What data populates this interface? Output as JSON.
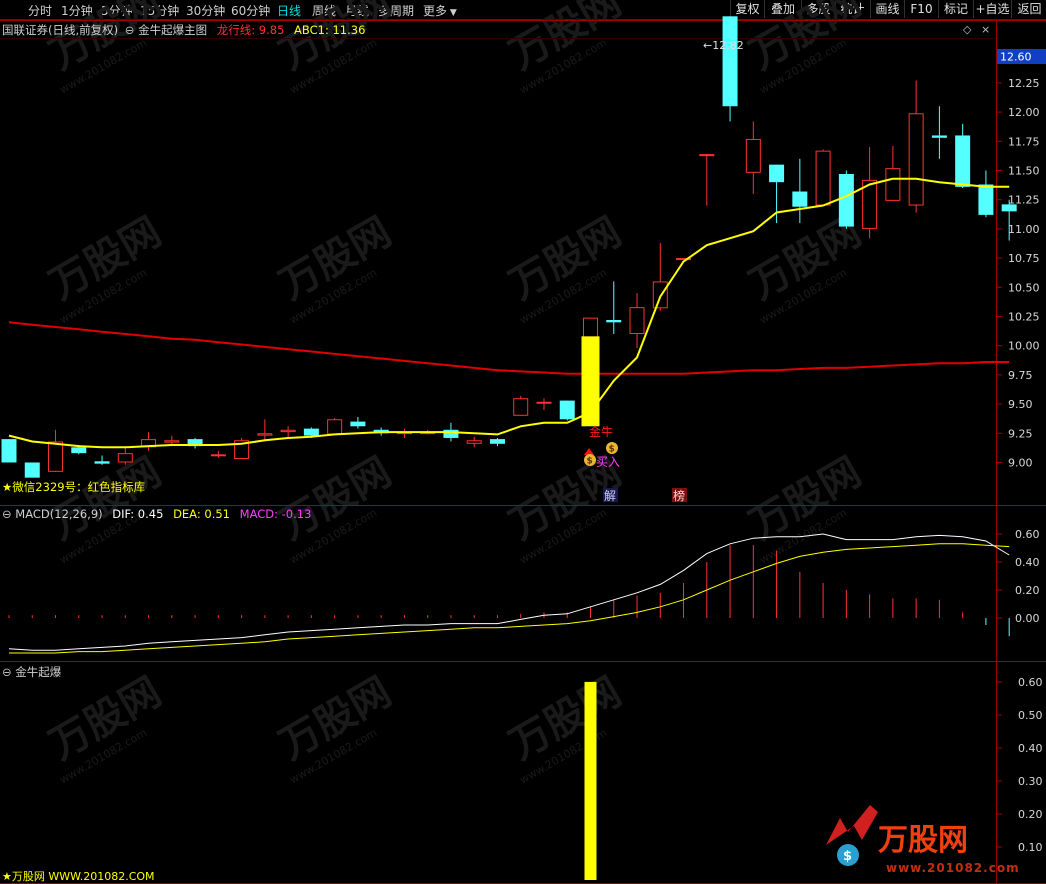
{
  "toolbar": {
    "periods": [
      {
        "label": "分时"
      },
      {
        "label": "1分钟"
      },
      {
        "label": "5分钟"
      },
      {
        "label": "15分钟"
      },
      {
        "label": "30分钟"
      },
      {
        "label": "60分钟"
      },
      {
        "label": "日线"
      },
      {
        "label": "周线"
      },
      {
        "label": "月线"
      },
      {
        "label": "多周期"
      },
      {
        "label": "更多"
      }
    ],
    "active_period": "日线",
    "tools": [
      {
        "label": "复权"
      },
      {
        "label": "叠加"
      },
      {
        "label": "多股"
      },
      {
        "label": "统计"
      },
      {
        "label": "画线"
      },
      {
        "label": "F10"
      },
      {
        "label": "标记"
      },
      {
        "label": "+自选"
      },
      {
        "label": "返回"
      }
    ]
  },
  "main_panel": {
    "stock": "国联证券(日线,前复权)",
    "indicator": "金牛起爆主图",
    "line1_label": "龙行线: 9.85",
    "line2_label": "ABC1: 11.36",
    "wechat_note": "★微信2329号：红色指标库",
    "signal_jin": "金牛",
    "signal_buy": "买入",
    "marker_jie": "解",
    "marker_bang": "榜",
    "max_label": "12.82",
    "current_price_tag": "12.60"
  },
  "macd_panel": {
    "title": "MACD(12,26,9)",
    "dif_label": "DIF: 0.45",
    "dea_label": "DEA: 0.51",
    "macd_label": "MACD: -0.13"
  },
  "sub_panel": {
    "title": "金牛起爆",
    "footer": "★万股网 WWW.201082.COM"
  },
  "watermark": {
    "brand": "万股网",
    "url": "www.201082.com",
    "logo_url": "www.201082.com"
  },
  "colors": {
    "background": "#000000",
    "up": "#ff3232",
    "down": "#54ffff",
    "yellow": "#ffff00",
    "red_line": "#e00000",
    "dif": "#ffffff",
    "dea": "#ffff00",
    "axis": "#a00000"
  },
  "chart_data": [
    {
      "type": "candlestick",
      "title": "金牛起爆主图",
      "ylim": [
        8.85,
        12.72
      ],
      "y_ticks": [
        9.0,
        9.25,
        9.5,
        9.75,
        10.0,
        10.25,
        10.5,
        10.75,
        11.0,
        11.25,
        11.5,
        11.75,
        12.0,
        12.25,
        12.5
      ],
      "candles": [
        {
          "o": 9.2,
          "h": 9.2,
          "l": 9.0,
          "c": 9.0
        },
        {
          "o": 9.0,
          "h": 9.0,
          "l": 8.87,
          "c": 8.87
        },
        {
          "o": 8.92,
          "h": 9.28,
          "l": 8.92,
          "c": 9.18
        },
        {
          "o": 9.13,
          "h": 9.15,
          "l": 9.07,
          "c": 9.08
        },
        {
          "o": 9.01,
          "h": 9.06,
          "l": 8.98,
          "c": 8.99
        },
        {
          "o": 9.0,
          "h": 9.13,
          "l": 8.98,
          "c": 9.08
        },
        {
          "o": 9.13,
          "h": 9.26,
          "l": 9.1,
          "c": 9.2
        },
        {
          "o": 9.17,
          "h": 9.23,
          "l": 9.15,
          "c": 9.19
        },
        {
          "o": 9.2,
          "h": 9.21,
          "l": 9.12,
          "c": 9.14
        },
        {
          "o": 9.06,
          "h": 9.1,
          "l": 9.04,
          "c": 9.07
        },
        {
          "o": 9.03,
          "h": 9.21,
          "l": 9.03,
          "c": 9.19
        },
        {
          "o": 9.23,
          "h": 9.37,
          "l": 9.18,
          "c": 9.25
        },
        {
          "o": 9.26,
          "h": 9.31,
          "l": 9.2,
          "c": 9.28
        },
        {
          "o": 9.29,
          "h": 9.3,
          "l": 9.21,
          "c": 9.23
        },
        {
          "o": 9.24,
          "h": 9.38,
          "l": 9.24,
          "c": 9.37
        },
        {
          "o": 9.35,
          "h": 9.39,
          "l": 9.29,
          "c": 9.31
        },
        {
          "o": 9.28,
          "h": 9.3,
          "l": 9.23,
          "c": 9.25
        },
        {
          "o": 9.25,
          "h": 9.29,
          "l": 9.21,
          "c": 9.26
        },
        {
          "o": 9.26,
          "h": 9.28,
          "l": 9.24,
          "c": 9.26
        },
        {
          "o": 9.28,
          "h": 9.34,
          "l": 9.18,
          "c": 9.21
        },
        {
          "o": 9.16,
          "h": 9.22,
          "l": 9.13,
          "c": 9.19
        },
        {
          "o": 9.2,
          "h": 9.21,
          "l": 9.14,
          "c": 9.16
        },
        {
          "o": 9.4,
          "h": 9.57,
          "l": 9.4,
          "c": 9.55
        },
        {
          "o": 9.52,
          "h": 9.55,
          "l": 9.45,
          "c": 9.52
        },
        {
          "o": 9.53,
          "h": 9.53,
          "l": 9.36,
          "c": 9.37
        },
        {
          "o": 9.48,
          "h": 10.24,
          "l": 9.48,
          "c": 10.24
        },
        {
          "o": 10.22,
          "h": 10.55,
          "l": 10.1,
          "c": 10.2
        },
        {
          "o": 10.1,
          "h": 10.45,
          "l": 9.98,
          "c": 10.33
        },
        {
          "o": 10.32,
          "h": 10.88,
          "l": 10.3,
          "c": 10.55
        },
        {
          "o": 10.75,
          "h": 10.75,
          "l": 10.75,
          "c": 10.75
        },
        {
          "o": 11.64,
          "h": 11.64,
          "l": 11.2,
          "c": 11.64
        },
        {
          "o": 12.82,
          "h": 12.82,
          "l": 11.92,
          "c": 12.05
        },
        {
          "o": 11.48,
          "h": 11.92,
          "l": 11.3,
          "c": 11.77
        },
        {
          "o": 11.55,
          "h": 11.55,
          "l": 11.05,
          "c": 11.4
        },
        {
          "o": 11.32,
          "h": 11.6,
          "l": 11.05,
          "c": 11.19
        },
        {
          "o": 11.2,
          "h": 11.68,
          "l": 11.2,
          "c": 11.67
        },
        {
          "o": 11.47,
          "h": 11.5,
          "l": 11.0,
          "c": 11.02
        },
        {
          "o": 11.0,
          "h": 11.7,
          "l": 10.92,
          "c": 11.42
        },
        {
          "o": 11.24,
          "h": 11.71,
          "l": 11.24,
          "c": 11.52
        },
        {
          "o": 11.2,
          "h": 12.27,
          "l": 11.14,
          "c": 11.99
        },
        {
          "o": 11.8,
          "h": 12.05,
          "l": 11.6,
          "c": 11.78
        },
        {
          "o": 11.8,
          "h": 11.9,
          "l": 11.35,
          "c": 11.36
        },
        {
          "o": 11.38,
          "h": 11.5,
          "l": 11.1,
          "c": 11.12
        },
        {
          "o": 11.21,
          "h": 11.25,
          "l": 10.9,
          "c": 11.15
        }
      ],
      "series": [
        {
          "name": "龙行线",
          "values": [
            10.2,
            10.18,
            10.16,
            10.14,
            10.12,
            10.1,
            10.08,
            10.06,
            10.05,
            10.03,
            10.01,
            9.99,
            9.97,
            9.95,
            9.93,
            9.91,
            9.89,
            9.87,
            9.85,
            9.83,
            9.81,
            9.79,
            9.78,
            9.77,
            9.76,
            9.76,
            9.76,
            9.76,
            9.76,
            9.76,
            9.77,
            9.78,
            9.79,
            9.79,
            9.8,
            9.81,
            9.81,
            9.82,
            9.83,
            9.84,
            9.85,
            9.85,
            9.86,
            9.86
          ]
        },
        {
          "name": "ABC1",
          "values": [
            9.23,
            9.18,
            9.16,
            9.14,
            9.13,
            9.13,
            9.14,
            9.15,
            9.15,
            9.15,
            9.16,
            9.19,
            9.21,
            9.22,
            9.24,
            9.25,
            9.26,
            9.26,
            9.26,
            9.26,
            9.25,
            9.24,
            9.31,
            9.34,
            9.34,
            9.43,
            9.7,
            9.9,
            10.42,
            10.72,
            10.86,
            10.92,
            10.98,
            11.14,
            11.17,
            11.2,
            11.28,
            11.38,
            11.43,
            11.43,
            11.4,
            11.38,
            11.36,
            11.36
          ]
        }
      ]
    },
    {
      "type": "bar",
      "title": "MACD(12,26,9)",
      "ylim": [
        -0.3,
        0.7
      ],
      "y_ticks": [
        0.0,
        0.2,
        0.4,
        0.6
      ],
      "series": [
        {
          "name": "DIF",
          "values": [
            -0.22,
            -0.23,
            -0.23,
            -0.22,
            -0.21,
            -0.2,
            -0.18,
            -0.17,
            -0.16,
            -0.15,
            -0.14,
            -0.12,
            -0.1,
            -0.09,
            -0.08,
            -0.07,
            -0.06,
            -0.05,
            -0.05,
            -0.04,
            -0.04,
            -0.04,
            -0.01,
            0.02,
            0.03,
            0.08,
            0.13,
            0.18,
            0.24,
            0.34,
            0.46,
            0.53,
            0.57,
            0.58,
            0.58,
            0.6,
            0.56,
            0.56,
            0.56,
            0.58,
            0.59,
            0.58,
            0.55,
            0.45
          ]
        },
        {
          "name": "DEA",
          "values": [
            -0.25,
            -0.25,
            -0.25,
            -0.24,
            -0.24,
            -0.23,
            -0.22,
            -0.21,
            -0.2,
            -0.19,
            -0.18,
            -0.17,
            -0.15,
            -0.14,
            -0.13,
            -0.12,
            -0.11,
            -0.1,
            -0.09,
            -0.08,
            -0.07,
            -0.07,
            -0.06,
            -0.05,
            -0.04,
            -0.02,
            0.01,
            0.04,
            0.08,
            0.13,
            0.2,
            0.27,
            0.33,
            0.39,
            0.44,
            0.47,
            0.49,
            0.5,
            0.51,
            0.52,
            0.53,
            0.53,
            0.52,
            0.51
          ]
        },
        {
          "name": "MACD",
          "values": [
            0.02,
            0.02,
            0.02,
            0.02,
            0.02,
            0.02,
            0.02,
            0.02,
            0.02,
            0.02,
            0.02,
            0.02,
            0.02,
            0.02,
            0.02,
            0.02,
            0.02,
            0.02,
            0.02,
            0.02,
            0.02,
            0.02,
            0.03,
            0.04,
            0.04,
            0.08,
            0.13,
            0.16,
            0.18,
            0.25,
            0.4,
            0.52,
            0.52,
            0.48,
            0.33,
            0.25,
            0.2,
            0.17,
            0.14,
            0.14,
            0.13,
            0.04,
            -0.05,
            -0.13
          ]
        }
      ]
    },
    {
      "type": "bar",
      "title": "金牛起爆",
      "ylim": [
        0.0,
        0.63
      ],
      "y_ticks": [
        0.1,
        0.2,
        0.3,
        0.4,
        0.5,
        0.6
      ],
      "values": [
        0,
        0,
        0,
        0,
        0,
        0,
        0,
        0,
        0,
        0,
        0,
        0,
        0,
        0,
        0,
        0,
        0,
        0,
        0,
        0,
        0,
        0,
        0,
        0,
        0,
        0.6,
        0,
        0,
        0,
        0,
        0,
        0,
        0,
        0,
        0,
        0,
        0,
        0,
        0,
        0,
        0,
        0,
        0,
        0
      ]
    }
  ]
}
